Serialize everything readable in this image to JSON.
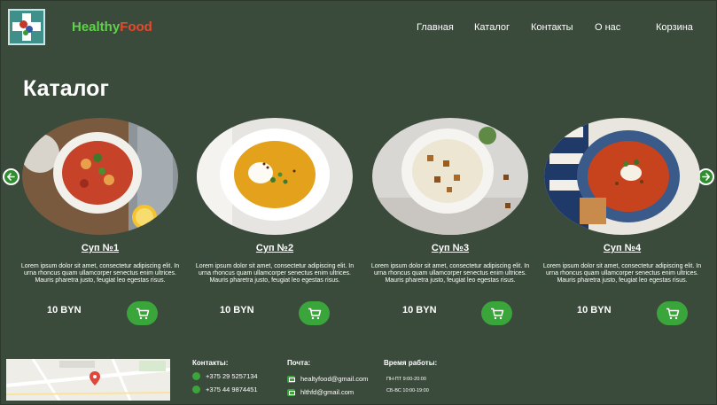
{
  "header": {
    "brand_part1": "Healthy",
    "brand_part2": "Food",
    "nav": [
      "Главная",
      "Каталог",
      "Контакты",
      "О нас"
    ],
    "cart": "Корзина"
  },
  "page_title": "Каталог",
  "products": [
    {
      "name": "Суп №1",
      "description": "Lorem ipsum dolor sit amet, consectetur adipiscing elit. In urna rhoncus quam ullamcorper senectus enim ultrices. Mauris pharetra justo, feugiat leo egestas risus.",
      "price": "10 BYN"
    },
    {
      "name": "Суп №2",
      "description": "Lorem ipsum dolor sit amet, consectetur adipiscing elit. In urna rhoncus quam ullamcorper senectus enim ultrices. Mauris pharetra justo, feugiat leo egestas risus.",
      "price": "10 BYN"
    },
    {
      "name": "Суп №3",
      "description": "Lorem ipsum dolor sit amet, consectetur adipiscing elit. In urna rhoncus quam ullamcorper senectus enim ultrices. Mauris pharetra justo, feugiat leo egestas risus.",
      "price": "10 BYN"
    },
    {
      "name": "Суп №4",
      "description": "Lorem ipsum dolor sit amet, consectetur adipiscing elit. In urna rhoncus quam ullamcorper senectus enim ultrices. Mauris pharetra justo, feugiat leo egestas risus.",
      "price": "10 BYN"
    }
  ],
  "footer": {
    "contacts_title": "Контакты:",
    "phones": [
      "+375 29 5257134",
      "+375 44 9874451"
    ],
    "mail_title": "Почта:",
    "emails": [
      "healtyfood@gmail.com",
      "hlthfd@gmail.com"
    ],
    "hours_title": "Время работы:",
    "hours": [
      "ПН-ПТ  9:00-20:00",
      "СБ-ВС   10:00-19:00"
    ]
  },
  "colors": {
    "background": "#3a4a3b",
    "accent_green": "#3aa53a",
    "brand_green": "#5fd14b",
    "brand_red": "#e8492c"
  },
  "icons": [
    "logo-cross-icon",
    "arrow-left-icon",
    "arrow-right-icon",
    "cart-icon",
    "phone-icon",
    "mail-icon",
    "map-pin-icon"
  ]
}
